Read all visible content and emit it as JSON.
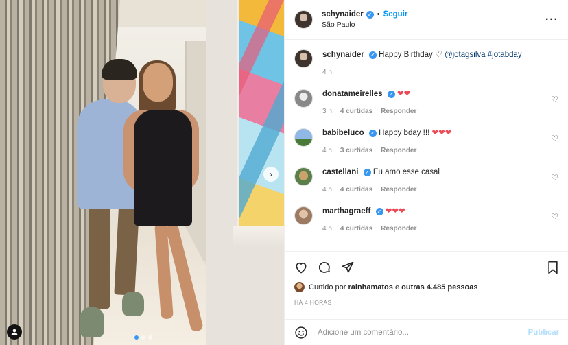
{
  "post": {
    "author": "schynaider",
    "follow_label": "Seguir",
    "location": "São Paulo"
  },
  "caption": {
    "username": "schynaider",
    "text": "Happy Birthday",
    "mention": "@jotagsilva",
    "hashtag": "#jotabday",
    "time": "4 h"
  },
  "comments": [
    {
      "username": "donatameirelles",
      "text": "",
      "hearts": 2,
      "time": "3 h",
      "likes": "4 curtidas",
      "reply": "Responder"
    },
    {
      "username": "babibeluco",
      "text": "Happy bday !!!",
      "hearts": 3,
      "time": "4 h",
      "likes": "3 curtidas",
      "reply": "Responder"
    },
    {
      "username": "castellani",
      "text": "Eu amo esse casal",
      "hearts": 0,
      "time": "4 h",
      "likes": "4 curtidas",
      "reply": "Responder"
    },
    {
      "username": "marthagraeff",
      "text": "",
      "hearts": 3,
      "time": "4 h",
      "likes": "4 curtidas",
      "reply": "Responder"
    }
  ],
  "likes": {
    "prefix": "Curtido por",
    "user": "rainhamatos",
    "middle": "e",
    "others": "outras 4.485 pessoas"
  },
  "time_ago": "HÁ 4 HORAS",
  "comment_box": {
    "placeholder": "Adicione um comentário...",
    "publish_label": "Publicar"
  },
  "colors": {
    "accent_blue": "#0095f6",
    "verified_blue": "#3897f0",
    "heart_red": "#ed4956",
    "muted": "#8e8e8e"
  },
  "icons": {
    "like": "heart-outline-icon",
    "comment": "comment-bubble-icon",
    "share": "paper-plane-icon",
    "save": "bookmark-icon",
    "emoji": "smiley-icon",
    "more": "ellipsis-icon"
  }
}
